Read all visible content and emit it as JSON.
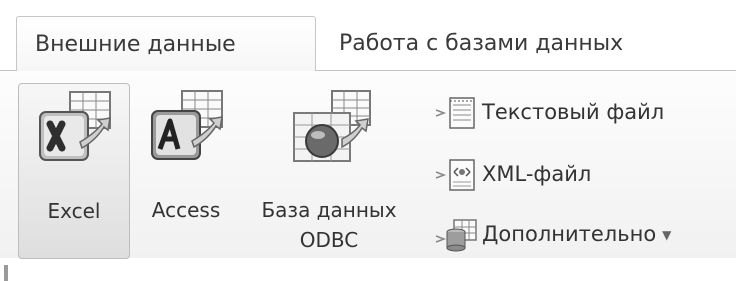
{
  "tabs": [
    {
      "label": "Внешние данные",
      "active": true
    },
    {
      "label": "Работа с базами данных",
      "active": false
    }
  ],
  "import_group": {
    "big_buttons": [
      {
        "label": "Excel",
        "icon": "excel-import-icon",
        "selected": true
      },
      {
        "label": "Access",
        "icon": "access-import-icon",
        "selected": false
      },
      {
        "label_line1": "База данных",
        "label_line2": "ODBC",
        "icon": "odbc-database-import-icon",
        "selected": false
      }
    ],
    "small_buttons": [
      {
        "label": "Текстовый файл",
        "icon": "text-file-import-icon"
      },
      {
        "label": "XML-файл",
        "icon": "xml-file-import-icon"
      },
      {
        "label": "Дополнительно",
        "icon": "more-import-icon",
        "has_dropdown": true
      }
    ]
  },
  "colors": {
    "excel_green": "#4a4a4a",
    "access_dark": "#3a3a3a",
    "grid_lines": "#777777",
    "selected_bg": "#e3e3e3"
  }
}
